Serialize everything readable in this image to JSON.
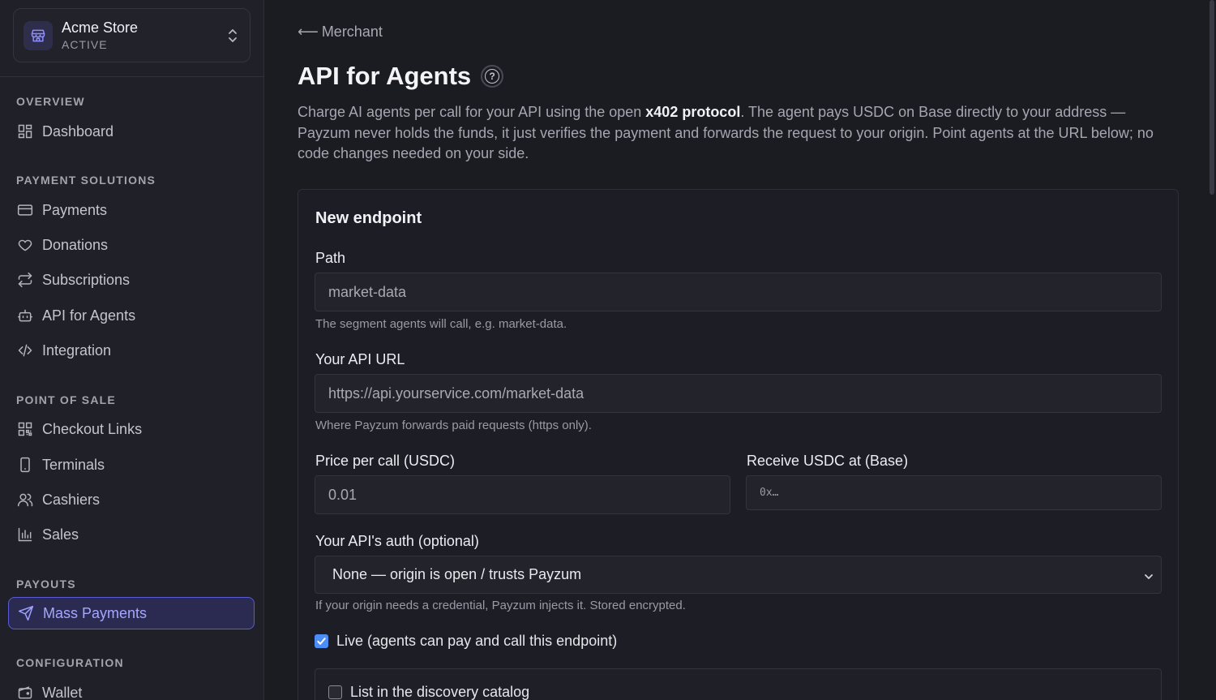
{
  "store": {
    "name": "Acme Store",
    "status": "ACTIVE"
  },
  "sidebar": {
    "sections": [
      {
        "title": "OVERVIEW"
      },
      {
        "title": "PAYMENT SOLUTIONS"
      },
      {
        "title": "POINT OF SALE"
      },
      {
        "title": "PAYOUTS"
      },
      {
        "title": "CONFIGURATION"
      }
    ],
    "items": {
      "dashboard": "Dashboard",
      "payments": "Payments",
      "donations": "Donations",
      "subscriptions": "Subscriptions",
      "api_for_agents": "API for Agents",
      "integration": "Integration",
      "checkout_links": "Checkout Links",
      "terminals": "Terminals",
      "cashiers": "Cashiers",
      "sales": "Sales",
      "mass_payments": "Mass Payments",
      "wallet": "Wallet"
    },
    "active_item": "mass_payments"
  },
  "main": {
    "back_label": "Merchant",
    "title": "API for Agents",
    "intro": {
      "part1": "Charge AI agents per call for your API using the open ",
      "protocol": "x402 protocol",
      "part2": ". The agent pays USDC on Base directly to your address — Payzum never holds the funds, it just verifies the payment and forwards the request to your origin. Point agents at the URL below; no code changes needed on your side."
    }
  },
  "form": {
    "title": "New endpoint",
    "path": {
      "label": "Path",
      "placeholder": "market-data",
      "hint": "The segment agents will call, e.g. market-data."
    },
    "api_url": {
      "label": "Your API URL",
      "placeholder": "https://api.yourservice.com/market-data",
      "hint": "Where Payzum forwards paid requests (https only)."
    },
    "price": {
      "label": "Price per call (USDC)",
      "placeholder": "0.01"
    },
    "receive": {
      "label": "Receive USDC at (Base)",
      "placeholder": "0x…"
    },
    "auth": {
      "label": "Your API's auth (optional)",
      "selected": "None — origin is open / trusts Payzum",
      "hint": "If your origin needs a credential, Payzum injects it. Stored encrypted."
    },
    "live": {
      "label": "Live (agents can pay and call this endpoint)",
      "checked": true
    },
    "discovery": {
      "label": "List in the discovery catalog",
      "checked": false
    }
  },
  "colors": {
    "accent": "#5b5bd6",
    "checkbox": "#4c8ef7",
    "background": "#1b1b22",
    "sidebar": "#202029"
  }
}
